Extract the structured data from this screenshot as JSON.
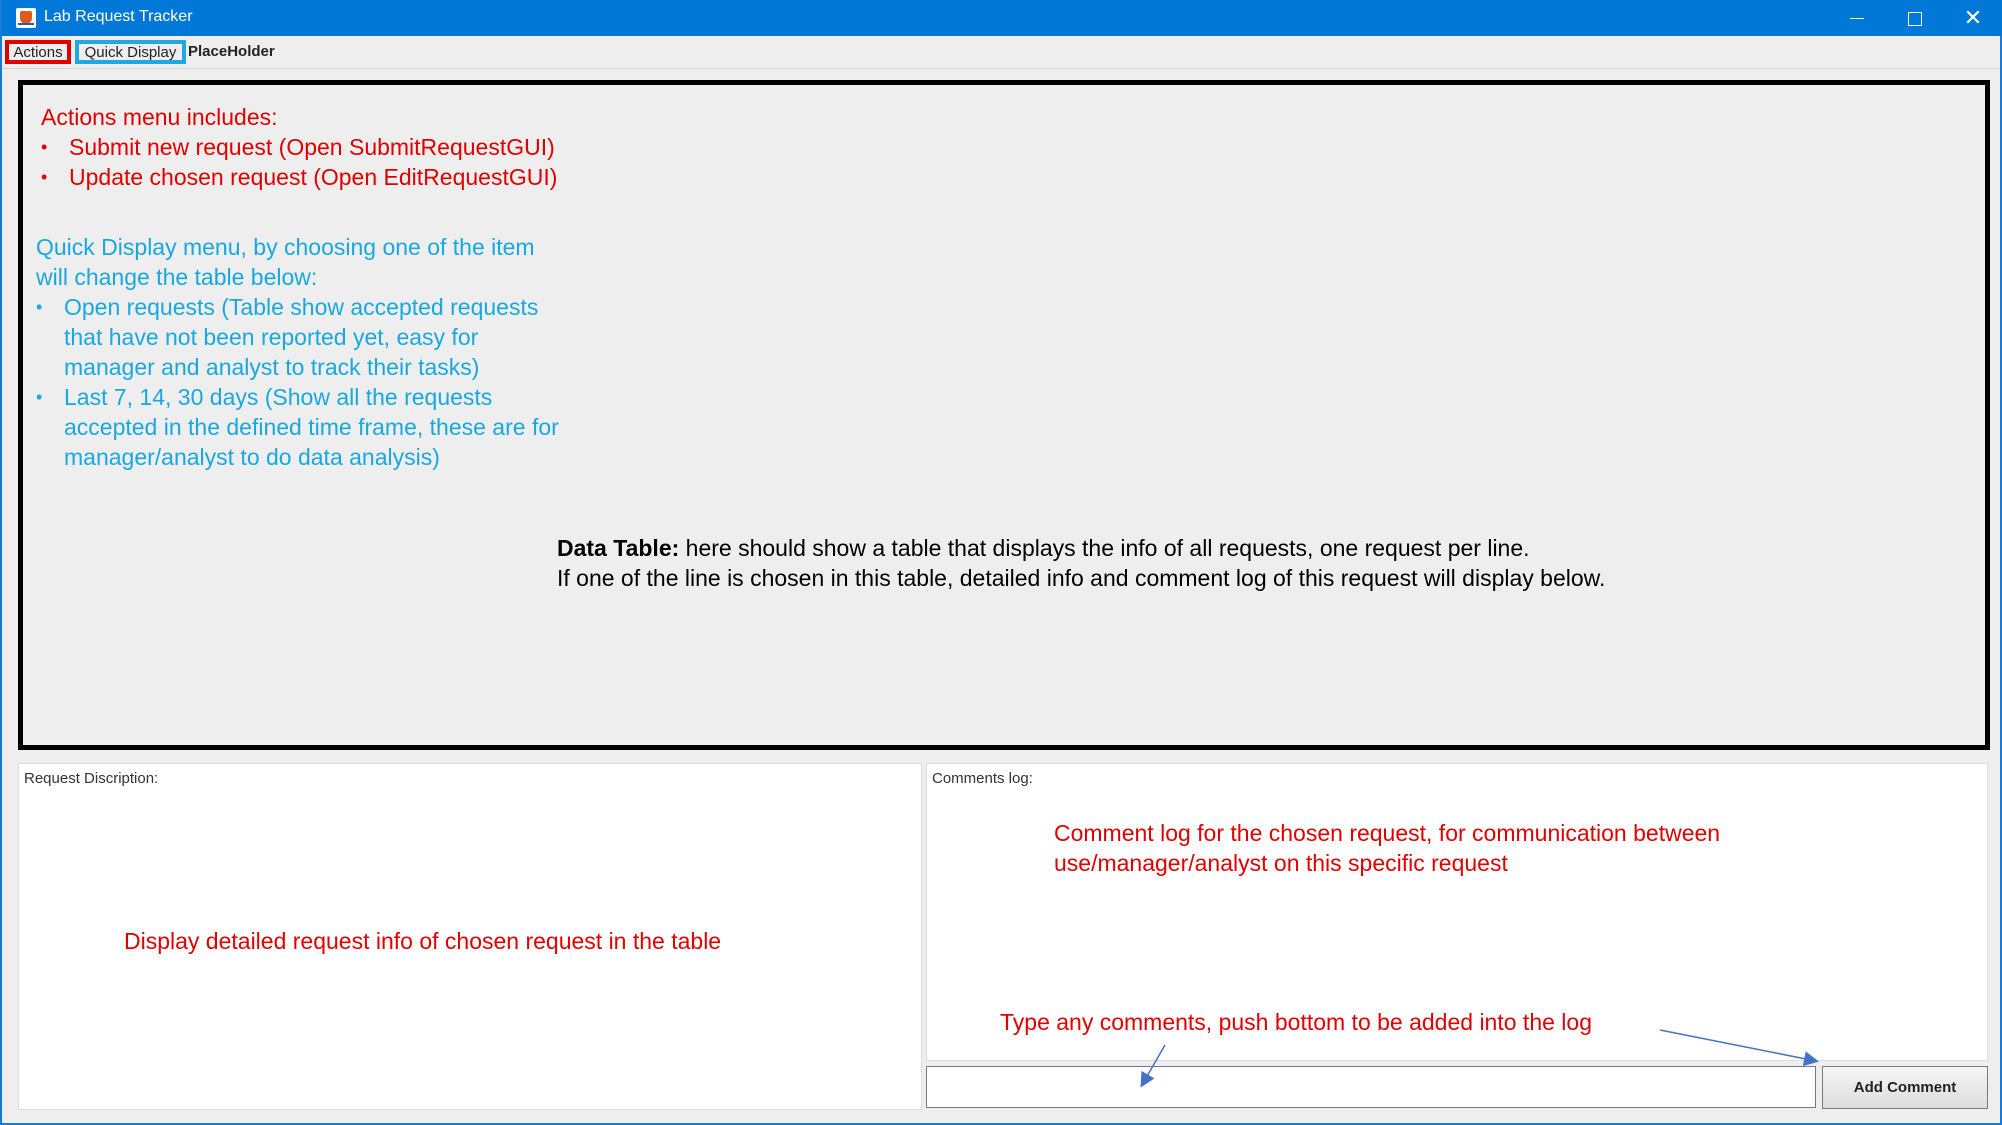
{
  "window": {
    "title": "Lab Request Tracker",
    "controls": {
      "minimize": "",
      "maximize": "",
      "close": "✕"
    }
  },
  "menubar": {
    "items": [
      {
        "label": "Actions"
      },
      {
        "label": "Quick Display"
      },
      {
        "label": "PlaceHolder"
      }
    ]
  },
  "annotations": {
    "actions_menu": {
      "heading": "Actions menu includes:",
      "items": [
        "Submit new request (Open SubmitRequestGUI)",
        "Update chosen request (Open EditRequestGUI)"
      ]
    },
    "quick_display_menu": {
      "heading_line1": "Quick Display menu, by choosing one of the item",
      "heading_line2": "will change the table below:",
      "items": [
        {
          "line1": "Open requests (Table show accepted requests",
          "line2": "that have not been reported yet, easy for",
          "line3": "manager and analyst to track their tasks)"
        },
        {
          "line1": "Last 7, 14, 30 days (Show all the requests",
          "line2": "accepted in the defined time frame, these are for",
          "line3": "manager/analyst to do data analysis)"
        }
      ]
    },
    "data_table": {
      "bold": "Data Table:",
      "line1_rest": " here should show a table that displays the info of all requests, one request per line.",
      "line2": "If one of the line is chosen in this table, detailed info and comment log of this request will display below."
    },
    "description_note": "Display detailed request info of chosen request in the table",
    "comments_note_line1": "Comment log for the chosen request, for communication between",
    "comments_note_line2": "use/manager/analyst on this specific request",
    "input_note": "Type any comments, push bottom to be added into the log"
  },
  "description_panel": {
    "label": "Request Discription:"
  },
  "comments_panel": {
    "label": "Comments log:"
  },
  "comment_input": {
    "value": ""
  },
  "add_comment_button": {
    "label": "Add Comment"
  },
  "colors": {
    "titlebar": "#0078d7",
    "annotation_red": "#e00000",
    "annotation_cyan": "#18a8e0"
  }
}
